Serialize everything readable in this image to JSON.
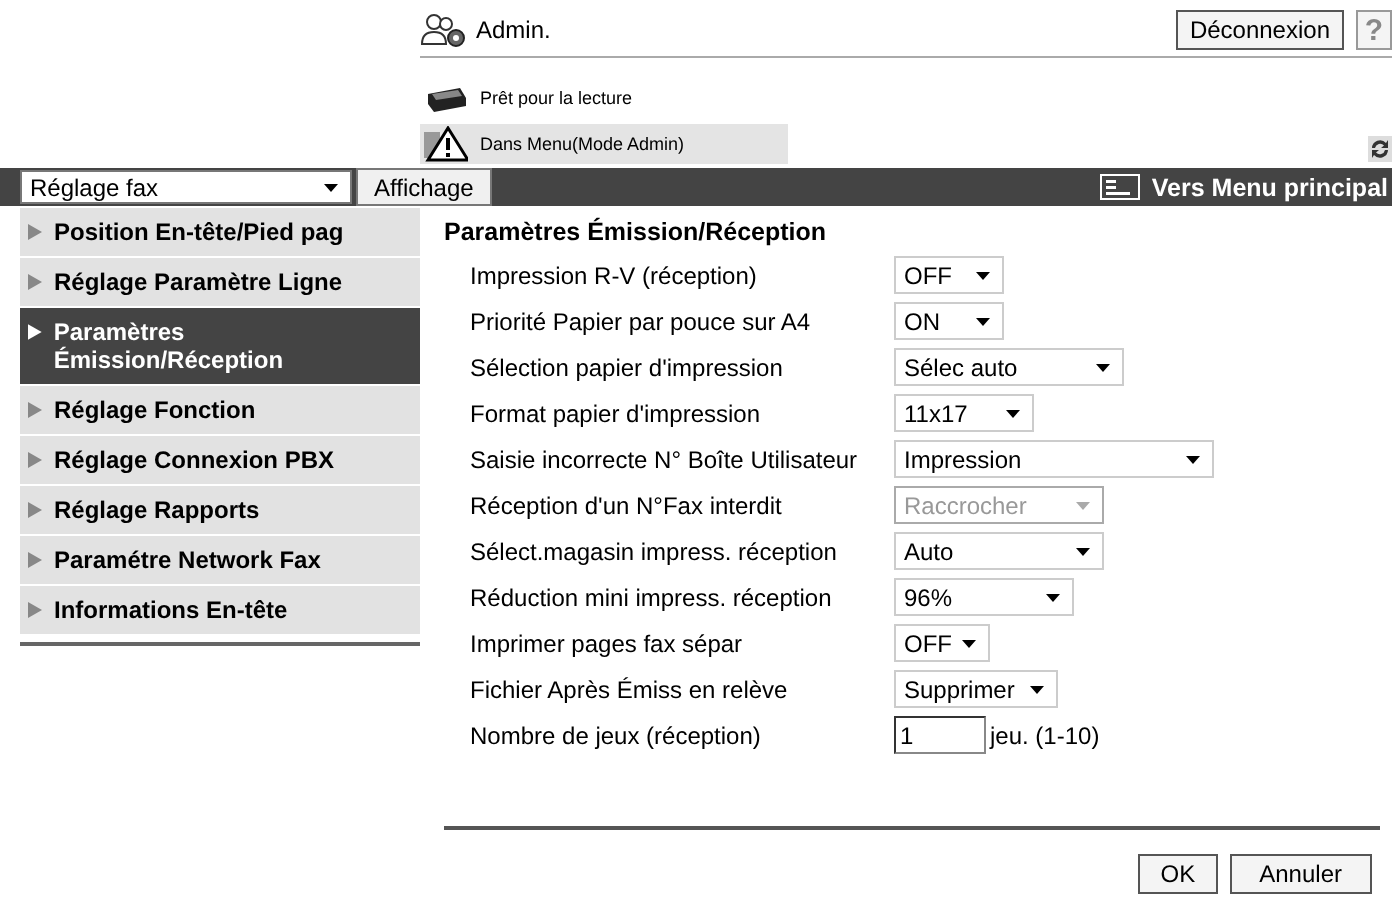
{
  "header": {
    "user": "Admin.",
    "logout_button": "Déconnexion",
    "help_button": "?"
  },
  "status": [
    {
      "kind": "printer",
      "text": "Prêt pour la lecture"
    },
    {
      "kind": "warning",
      "text": "Dans Menu(Mode Admin)"
    }
  ],
  "toolbar": {
    "category_select": "Réglage fax",
    "display_button": "Affichage",
    "main_menu_link": "Vers Menu principal"
  },
  "sidebar": {
    "items": [
      {
        "label": "Position En-tête/Pied pag",
        "selected": false
      },
      {
        "label": "Réglage Paramètre Ligne",
        "selected": false
      },
      {
        "label": "Paramètres Émission/Réception",
        "selected": true
      },
      {
        "label": "Réglage Fonction",
        "selected": false
      },
      {
        "label": "Réglage Connexion PBX",
        "selected": false
      },
      {
        "label": "Réglage Rapports",
        "selected": false
      },
      {
        "label": "Paramétre Network Fax",
        "selected": false
      },
      {
        "label": "Informations En-tête",
        "selected": false
      }
    ]
  },
  "form": {
    "title": "Paramètres Émission/Réception",
    "fields": [
      {
        "kind": "select",
        "label": "Impression R-V (réception)",
        "value": "OFF",
        "disabled": false
      },
      {
        "kind": "select",
        "label": "Priorité Papier par pouce sur A4",
        "value": "ON",
        "disabled": false
      },
      {
        "kind": "select",
        "label": "Sélection papier d'impression",
        "value": "Sélec auto",
        "disabled": false
      },
      {
        "kind": "select",
        "label": "Format papier d'impression",
        "value": "11x17",
        "disabled": false
      },
      {
        "kind": "select",
        "label": "Saisie incorrecte N° Boîte Utilisateur",
        "value": "Impression",
        "disabled": false
      },
      {
        "kind": "select",
        "label": "Réception d'un N°Fax interdit",
        "value": "Raccrocher",
        "disabled": true
      },
      {
        "kind": "select",
        "label": "Sélect.magasin impress. réception",
        "value": "Auto",
        "disabled": false
      },
      {
        "kind": "select",
        "label": "Réduction mini impress. réception",
        "value": "96%",
        "disabled": false
      },
      {
        "kind": "select",
        "label": "Imprimer pages fax sépar",
        "value": "OFF",
        "disabled": false
      },
      {
        "kind": "select",
        "label": "Fichier Après Émiss en relève",
        "value": "Supprimer",
        "disabled": false
      },
      {
        "kind": "input",
        "label": "Nombre de jeux (réception)",
        "value": "1",
        "suffix": "jeu. (1-10)"
      }
    ],
    "buttons": [
      "OK",
      "Annuler"
    ]
  }
}
